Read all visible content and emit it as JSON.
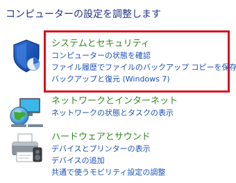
{
  "page_title": "コンピューターの設定を調整します",
  "colors": {
    "heading_green": "#2e8a1c",
    "link_blue": "#1a4fb5",
    "title_blue": "#1e3287",
    "highlight_red": "#d8101c"
  },
  "categories": [
    {
      "id": "security",
      "icon": "shield-icon",
      "heading": "システムとセキュリティ",
      "links": [
        "コンピューターの状態を確認",
        "ファイル履歴でファイルのバックアップ コピーを保存",
        "バックアップと復元 (Windows 7)"
      ],
      "highlighted": true
    },
    {
      "id": "network",
      "icon": "network-globe-icon",
      "heading": "ネットワークとインターネット",
      "links": [
        "ネットワークの状態とタスクの表示"
      ],
      "highlighted": false
    },
    {
      "id": "hardware",
      "icon": "printer-icon",
      "heading": "ハードウェアとサウンド",
      "links": [
        "デバイスとプリンターの表示",
        "デバイスの追加",
        "共通で使うモビリティ設定の調整"
      ],
      "highlighted": false
    }
  ]
}
